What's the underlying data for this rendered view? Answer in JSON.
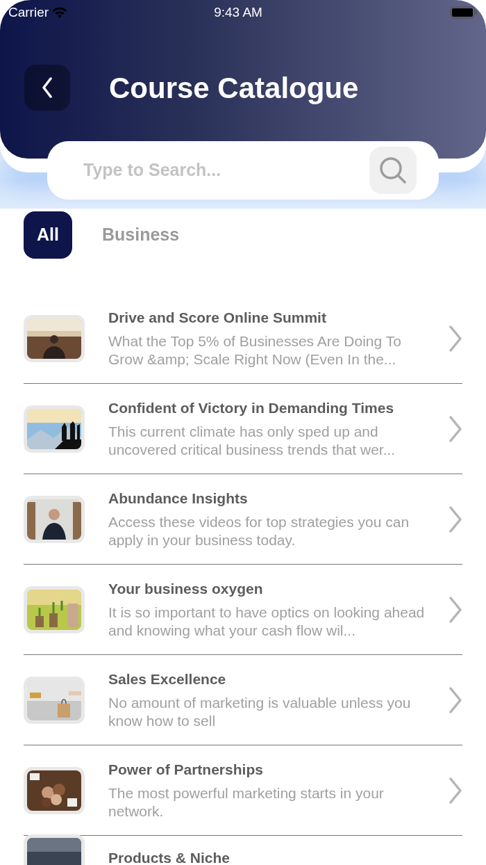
{
  "status_bar": {
    "carrier": "Carrier",
    "time": "9:43 AM"
  },
  "header": {
    "title": "Course Catalogue"
  },
  "search": {
    "placeholder": "Type to Search..."
  },
  "filters": [
    {
      "label": "All",
      "selected": true
    },
    {
      "label": "Business",
      "selected": false
    }
  ],
  "courses": [
    {
      "title": "Drive and Score Online Summit",
      "description": "What the Top 5% of Businesses Are Doing To Grow &amp; Scale Right Now (Even In the..."
    },
    {
      "title": "Confident of Victory in Demanding Times",
      "description": "This current climate has only sped up and uncovered critical business trends that wer..."
    },
    {
      "title": "Abundance Insights",
      "description": "Access these videos for top strategies you can apply in your business today."
    },
    {
      "title": "Your business oxygen",
      "description": "It is so important to have optics on looking ahead and knowing what your cash flow wil..."
    },
    {
      "title": "Sales Excellence",
      "description": "No amount of marketing is valuable unless you know how to sell"
    },
    {
      "title": "Power of Partnerships",
      "description": "The most powerful marketing starts in your network."
    },
    {
      "title": "Products & Niche"
    }
  ]
}
